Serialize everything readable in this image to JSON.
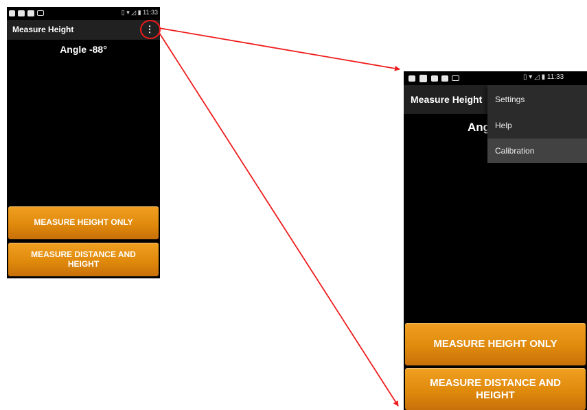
{
  "colors": {
    "accent_orange": "#e8900f",
    "app_bar": "#212121",
    "menu_bg": "#2b2b2b",
    "annotation_red": "#ee1c1c"
  },
  "left_screen": {
    "status_bar": {
      "time": "11:33",
      "icons": [
        "app-notification-icon",
        "play-icon",
        "play-icon",
        "laptop-icon"
      ]
    },
    "app_bar": {
      "title": "Measure Height",
      "overflow_icon": "more-vert-icon"
    },
    "angle_label": "Angle -88°",
    "buttons": {
      "measure_height_only": "MEASURE HEIGHT ONLY",
      "measure_distance_and_height": "MEASURE DISTANCE AND HEIGHT"
    }
  },
  "right_screen": {
    "status_bar": {
      "time": "11:33",
      "icons": [
        "image-icon",
        "app-notification-icon",
        "play-icon",
        "play-icon",
        "laptop-icon"
      ]
    },
    "app_bar": {
      "title": "Measure Height"
    },
    "angle_label_partial": "Ang",
    "overflow_menu": {
      "items": [
        {
          "label": "Settings"
        },
        {
          "label": "Help"
        },
        {
          "label": "Calibration",
          "highlighted": true
        }
      ]
    },
    "buttons": {
      "measure_height_only": "MEASURE HEIGHT ONLY",
      "measure_distance_and_height": "MEASURE DISTANCE AND HEIGHT"
    }
  }
}
